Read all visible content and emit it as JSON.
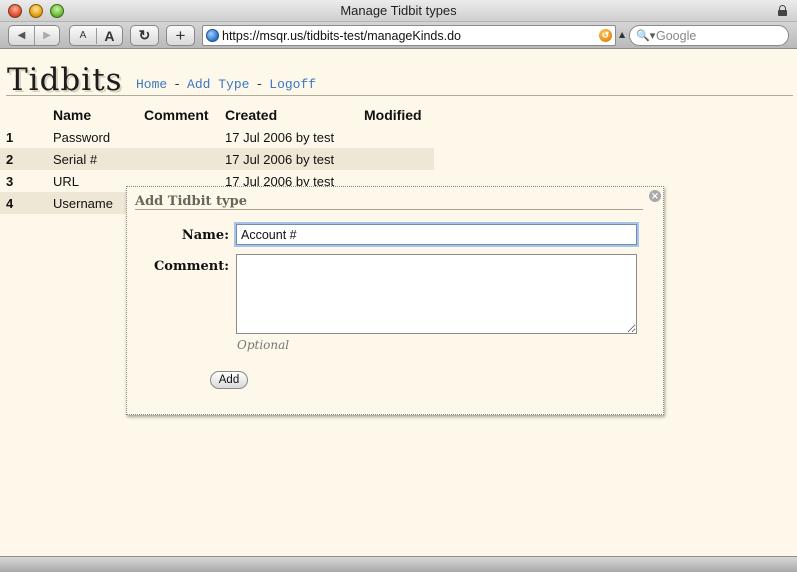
{
  "window": {
    "title": "Manage Tidbit types"
  },
  "toolbar": {
    "back_glyph": "◀",
    "forward_glyph": "▶",
    "font_small": "A",
    "font_big": "A",
    "reload_glyph": "↻",
    "add_glyph": "+",
    "url": "https://msqr.us/tidbits-test/manageKinds.do",
    "search_placeholder": "Google",
    "search_glyph": "🔍▾"
  },
  "page": {
    "logo": "Tidbits",
    "nav": {
      "home": "Home",
      "add_type": "Add Type",
      "logoff": "Logoff",
      "sep": "-"
    }
  },
  "table": {
    "headers": [
      "Name",
      "Comment",
      "Created",
      "Modified"
    ],
    "rows": [
      {
        "num": "1",
        "name": "Password",
        "comment": "",
        "created": "17 Jul 2006 by test",
        "modified": ""
      },
      {
        "num": "2",
        "name": "Serial #",
        "comment": "",
        "created": "17 Jul 2006 by test",
        "modified": ""
      },
      {
        "num": "3",
        "name": "URL",
        "comment": "",
        "created": "17 Jul 2006 by test",
        "modified": ""
      },
      {
        "num": "4",
        "name": "Username",
        "comment": "",
        "created": "",
        "modified": ""
      }
    ]
  },
  "dialog": {
    "title": "Add Tidbit type",
    "close_glyph": "×",
    "name_label": "Name:",
    "name_value": "Account #",
    "comment_label": "Comment:",
    "comment_value": "",
    "optional_note": "Optional",
    "add_button": "Add"
  }
}
